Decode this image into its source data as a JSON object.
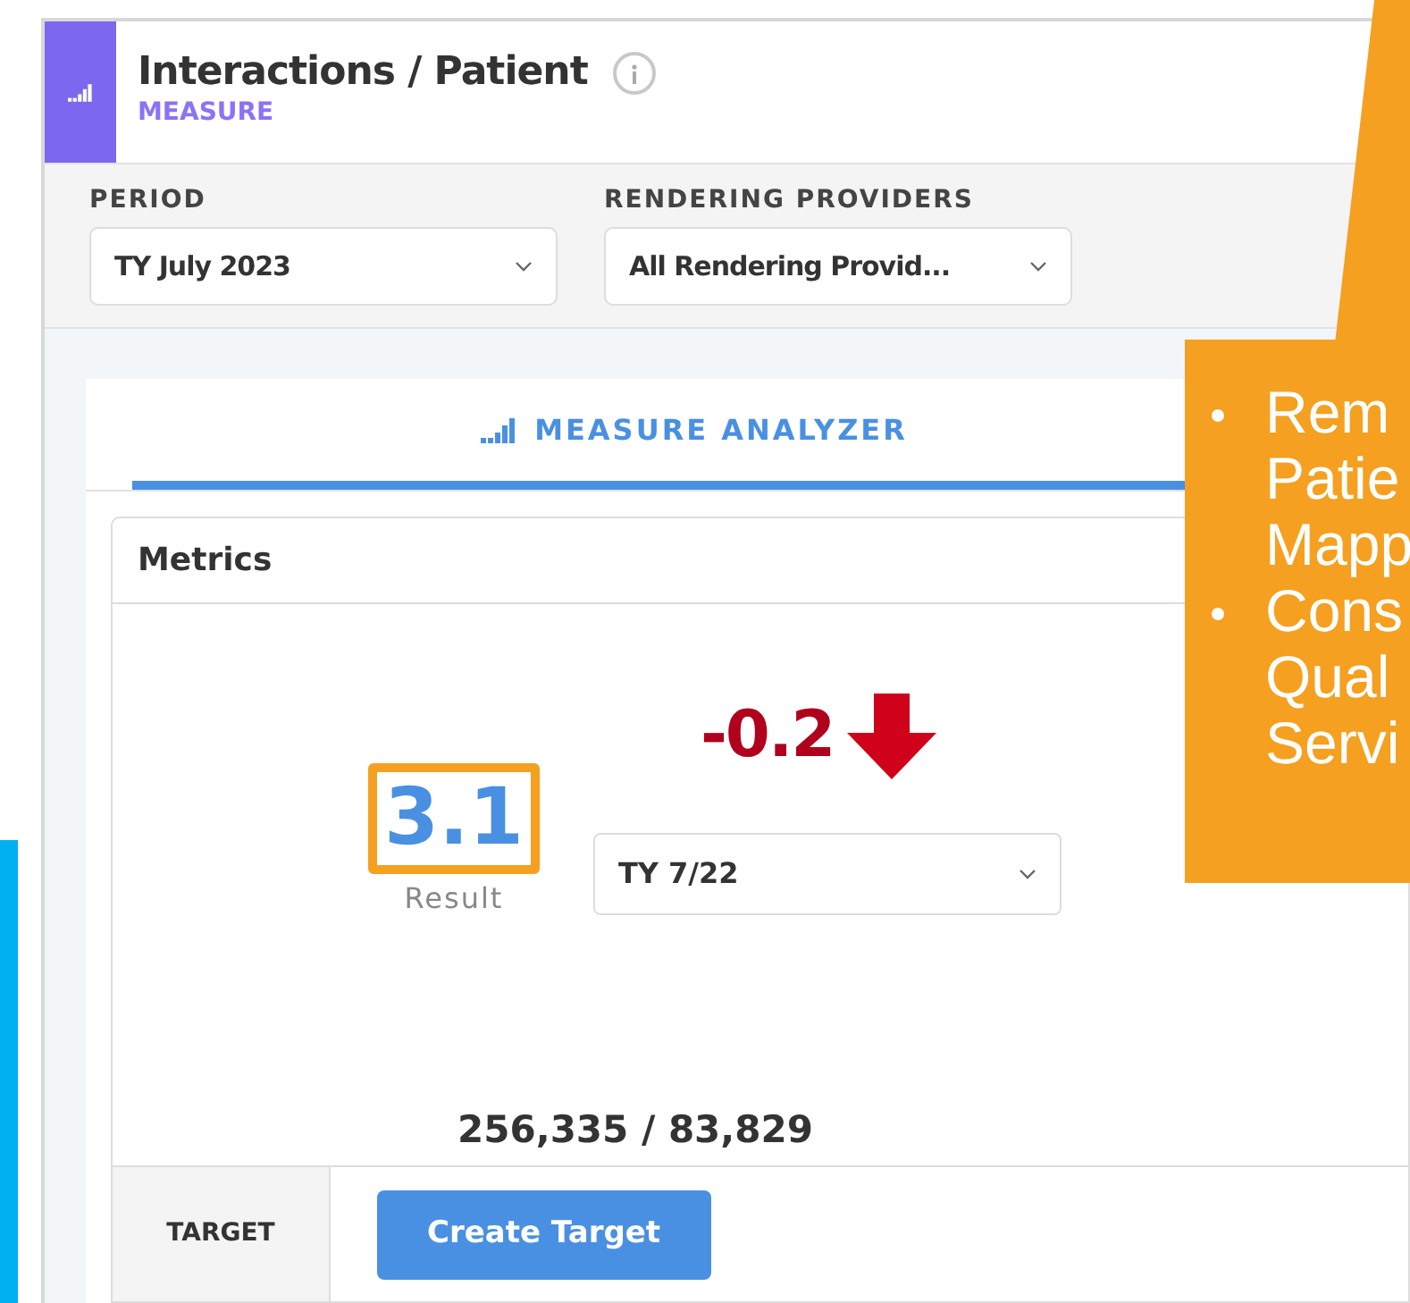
{
  "header": {
    "title": "Interactions / Patient",
    "subtitle": "MEASURE"
  },
  "filters": [
    {
      "label": "PERIOD",
      "value": "TY July 2023"
    },
    {
      "label": "RENDERING PROVIDERS",
      "value": "All Rendering Provid..."
    }
  ],
  "tabs": [
    {
      "label": "MEASURE ANALYZER",
      "selected": true
    }
  ],
  "metrics": {
    "title": "Metrics",
    "result": "3.1",
    "result_label": "Result",
    "change": "-0.2",
    "compare_value": "TY 7/22",
    "ratio": "256,335 / 83,829"
  },
  "target": {
    "label": "TARGET",
    "button": "Create Target"
  },
  "callout": {
    "bullets": [
      {
        "lines": [
          "Rem",
          "Patie",
          "Mapp"
        ]
      },
      {
        "lines": [
          "Cons",
          "Qual",
          "Servi"
        ]
      }
    ]
  }
}
